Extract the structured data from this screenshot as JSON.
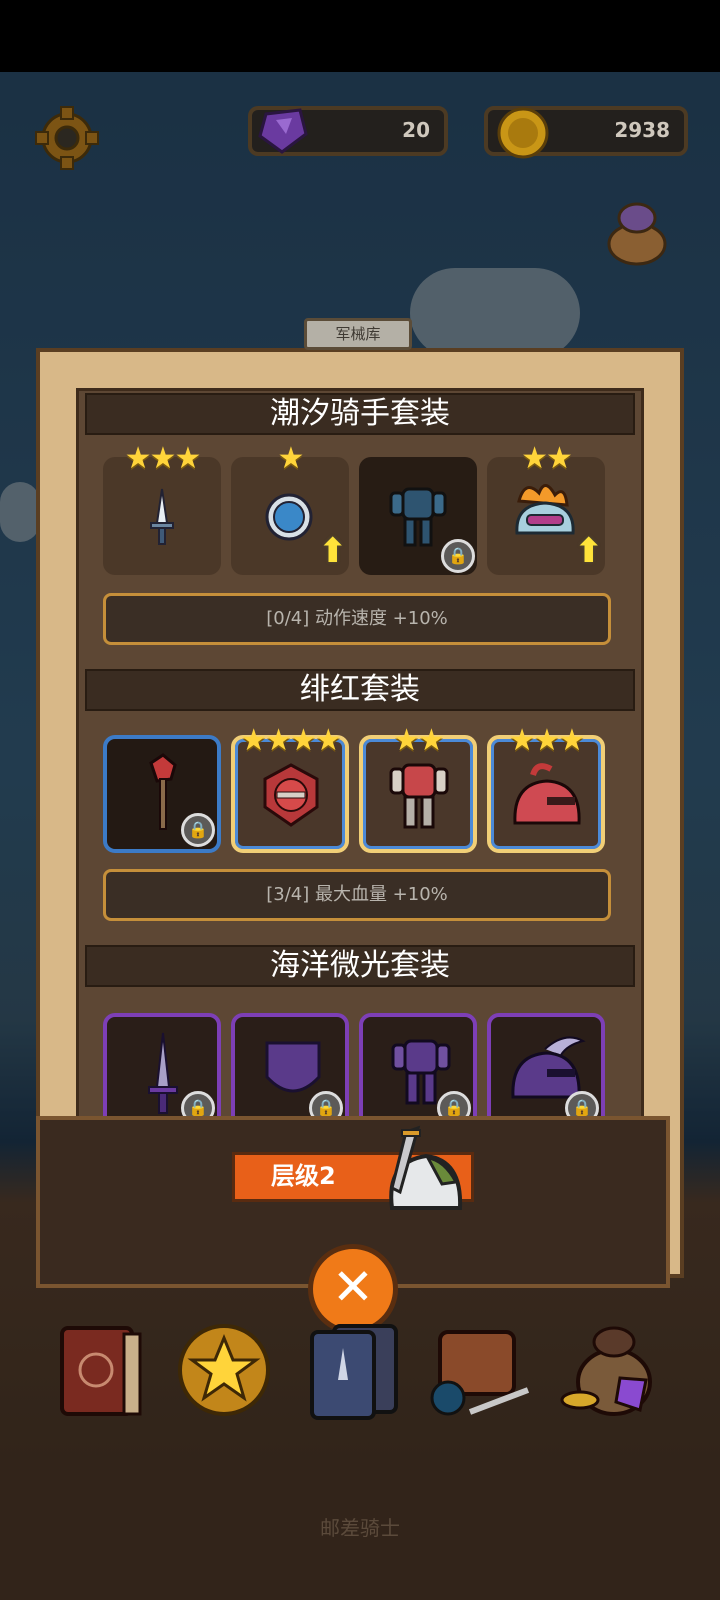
{
  "hud": {
    "gems": "20",
    "coins": "2938"
  },
  "panel": {
    "tag": "军械库",
    "sets": [
      {
        "title": "潮汐骑手套装",
        "items": [
          {
            "icon": "dagger-icon",
            "stars": "★★★",
            "upgrade": false,
            "locked": false
          },
          {
            "icon": "blue-ring-icon",
            "stars": "★",
            "upgrade": true,
            "locked": false
          },
          {
            "icon": "armor-icon",
            "stars": "",
            "upgrade": false,
            "locked": true
          },
          {
            "icon": "flame-helmet-icon",
            "stars": "★★",
            "upgrade": true,
            "locked": false
          }
        ],
        "bonus": "[0/4] 动作速度 +10%"
      },
      {
        "title": "绯红套装",
        "items": [
          {
            "icon": "red-mace-icon",
            "stars": "",
            "locked": true
          },
          {
            "icon": "red-shield-icon",
            "stars": "★★★★",
            "locked": false
          },
          {
            "icon": "red-armor-icon",
            "stars": "★★",
            "locked": false
          },
          {
            "icon": "red-helmet-icon",
            "stars": "★★★",
            "locked": false
          }
        ],
        "bonus": "[3/4] 最大血量 +10%"
      },
      {
        "title": "海洋微光套装",
        "items": [
          {
            "icon": "purple-sword-icon",
            "locked": true
          },
          {
            "icon": "purple-shield-icon",
            "locked": true
          },
          {
            "icon": "purple-armor-icon",
            "locked": true
          },
          {
            "icon": "purple-helmet-icon",
            "locked": true
          }
        ]
      }
    ]
  },
  "level": {
    "label": "层级2"
  },
  "close": {
    "symbol": "✕"
  },
  "nav": [
    "book-icon",
    "coin-icon",
    "cards-icon",
    "backpack-icon",
    "gem-bag-icon"
  ],
  "footer": {
    "text": "邮差骑士"
  }
}
